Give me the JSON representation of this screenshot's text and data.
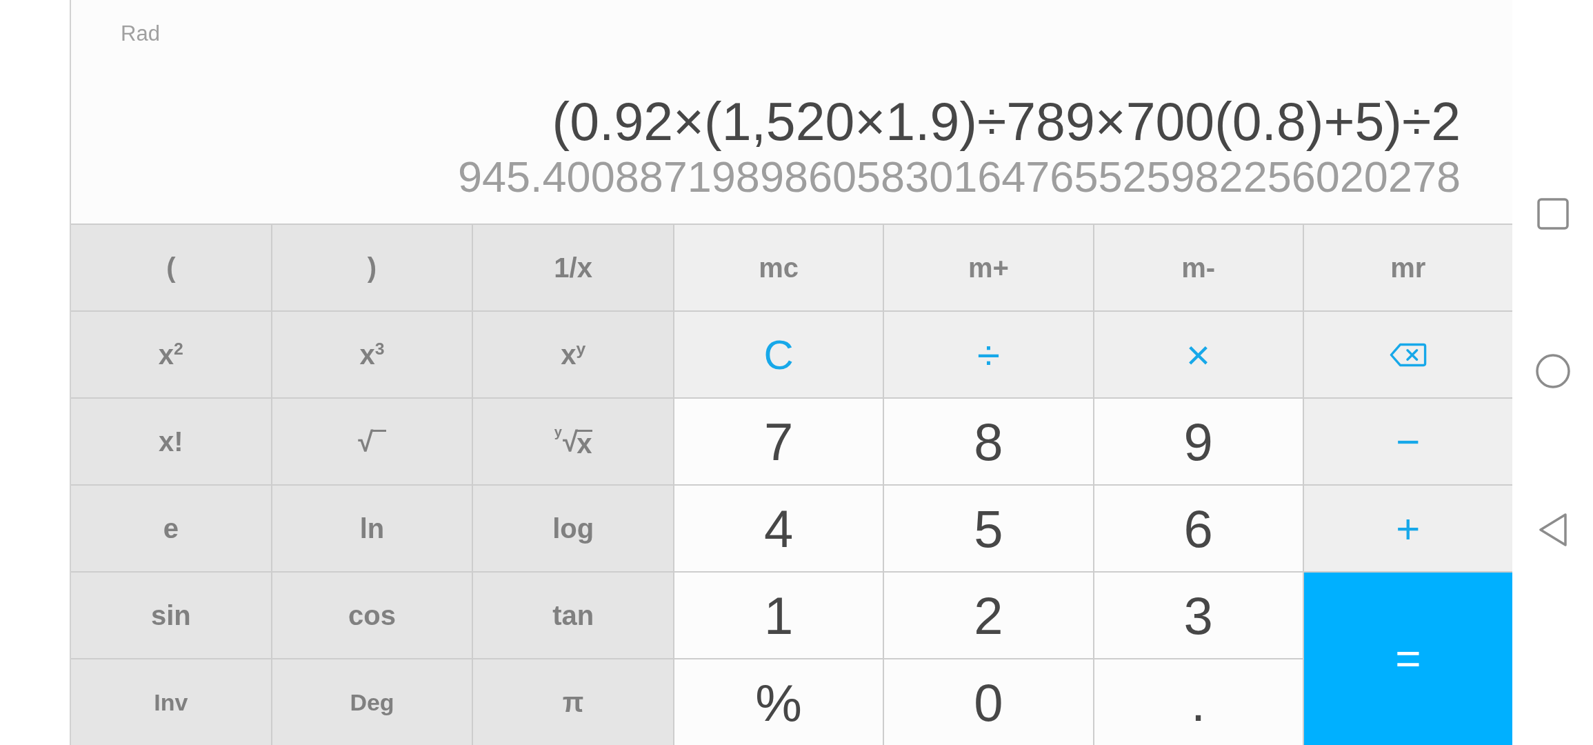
{
  "display": {
    "angle_mode": "Rad",
    "expression": "(0.92×(1,520×1.9)÷789×700(0.8)+5)÷2",
    "result": "945.40088719898605830164765525982256020278"
  },
  "scientific_keys": [
    {
      "kind": "function",
      "label": "("
    },
    {
      "kind": "function",
      "label": ")"
    },
    {
      "kind": "function",
      "label": "1/x"
    },
    {
      "kind": "function",
      "label": "x$^{2}$"
    },
    {
      "kind": "function",
      "label": "x$^{3}$"
    },
    {
      "kind": "function",
      "label": "x$^{y}$"
    },
    {
      "kind": "function",
      "label": "x!"
    },
    {
      "kind": "root",
      "sign": "√"
    },
    {
      "kind": "root",
      "index": "y",
      "sign": "√",
      "radicand": "x"
    },
    {
      "kind": "function",
      "label": "e"
    },
    {
      "kind": "function",
      "label": "ln"
    },
    {
      "kind": "function",
      "label": "log"
    },
    {
      "kind": "function",
      "label": "sin"
    },
    {
      "kind": "function",
      "label": "cos"
    },
    {
      "kind": "function",
      "label": "tan"
    },
    {
      "kind": "toggle",
      "label": "Inv"
    },
    {
      "kind": "toggle",
      "label": "Deg"
    },
    {
      "kind": "function",
      "label": "π"
    }
  ],
  "keypad": [
    {
      "kind": "memory",
      "label": "mc"
    },
    {
      "kind": "memory",
      "label": "m+"
    },
    {
      "kind": "memory",
      "label": "m-"
    },
    {
      "kind": "memory",
      "label": "mr"
    },
    {
      "kind": "operator",
      "label": "C"
    },
    {
      "kind": "operator",
      "label": "÷"
    },
    {
      "kind": "operator",
      "label": "×"
    },
    {
      "kind": "backspace"
    },
    {
      "kind": "digit",
      "label": "7"
    },
    {
      "kind": "digit",
      "label": "8"
    },
    {
      "kind": "digit",
      "label": "9"
    },
    {
      "kind": "operator",
      "label": "−"
    },
    {
      "kind": "digit",
      "label": "4"
    },
    {
      "kind": "digit",
      "label": "5"
    },
    {
      "kind": "digit",
      "label": "6"
    },
    {
      "kind": "operator",
      "label": "+"
    },
    {
      "kind": "digit",
      "label": "1"
    },
    {
      "kind": "digit",
      "label": "2"
    },
    {
      "kind": "digit",
      "label": "3"
    },
    {
      "kind": "equals",
      "label": "="
    },
    {
      "kind": "digit",
      "label": "%"
    },
    {
      "kind": "digit",
      "label": "0"
    },
    {
      "kind": "digit",
      "label": "."
    }
  ],
  "navigation_bar": {
    "buttons": [
      {
        "kind": "recents"
      },
      {
        "kind": "home"
      },
      {
        "kind": "back"
      }
    ]
  }
}
